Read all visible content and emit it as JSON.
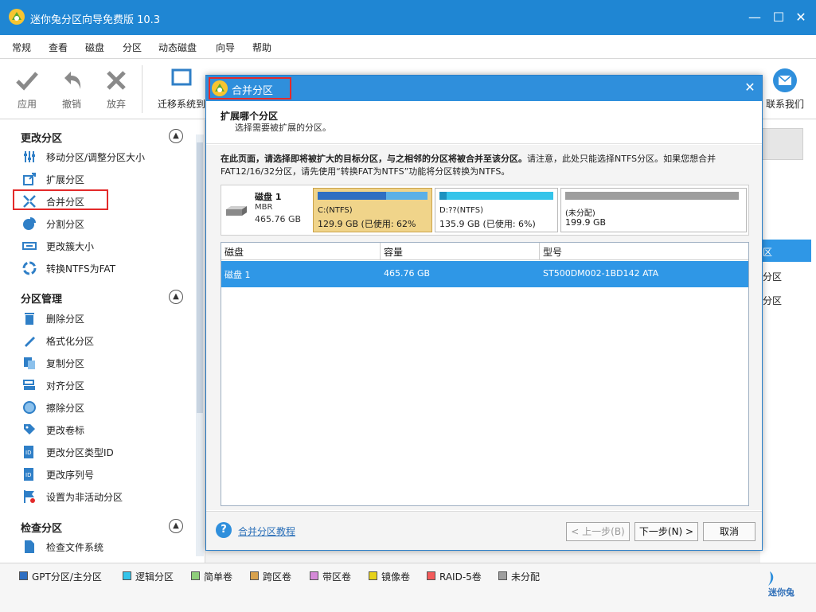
{
  "window": {
    "title": "迷你兔分区向导免费版 10.3",
    "minimize": "—",
    "maximize": "☐",
    "close": "✕"
  },
  "menu": [
    "常规",
    "查看",
    "磁盘",
    "分区",
    "动态磁盘",
    "向导",
    "帮助"
  ],
  "toolbar": {
    "apply": "应用",
    "undo": "撤销",
    "discard": "放弃",
    "migrate": "迁移系统到",
    "contact": "联系我们"
  },
  "sidebar": {
    "sections": [
      {
        "title": "更改分区",
        "items": [
          "移动分区/调整分区大小",
          "扩展分区",
          "合并分区",
          "分割分区",
          "更改簇大小",
          "转换NTFS为FAT"
        ]
      },
      {
        "title": "分区管理",
        "items": [
          "删除分区",
          "格式化分区",
          "复制分区",
          "对齐分区",
          "擦除分区",
          "更改卷标",
          "更改分区类型ID",
          "更改序列号",
          "设置为非活动分区"
        ]
      },
      {
        "title": "检查分区",
        "items": [
          "检查文件系统"
        ]
      }
    ]
  },
  "background_right": {
    "items": [
      "区",
      "分区",
      "分区"
    ]
  },
  "legend": [
    {
      "label": "GPT分区/主分区",
      "color": "#2f6fc2"
    },
    {
      "label": "逻辑分区",
      "color": "#35c4ea"
    },
    {
      "label": "简单卷",
      "color": "#8fce7b"
    },
    {
      "label": "跨区卷",
      "color": "#d8a24e"
    },
    {
      "label": "带区卷",
      "color": "#d58ad8"
    },
    {
      "label": "镜像卷",
      "color": "#e6d21b"
    },
    {
      "label": "RAID-5卷",
      "color": "#f35b5b"
    },
    {
      "label": "未分配",
      "color": "#9e9e9e"
    }
  ],
  "brand": "迷你兔",
  "dialog": {
    "title": "合并分区",
    "close": "✕",
    "heading": "扩展哪个分区",
    "subheading": "选择需要被扩展的分区。",
    "desc_bold": "在此页面，请选择即将被扩大的目标分区，与之相邻的分区将被合并至该分区。",
    "desc_rest": "请注意，此处只能选择NTFS分区。如果您想合并FAT12/16/32分区，请先使用“转换FAT为NTFS”功能将分区转换为NTFS。",
    "disk": {
      "name": "磁盘 1",
      "type": "MBR",
      "size": "465.76 GB"
    },
    "partitions": [
      {
        "label": "C:(NTFS)",
        "detail": "129.9 GB (已使用: 62%",
        "used": 0.62,
        "selected": true
      },
      {
        "label": "D:??(NTFS)",
        "detail": "135.9 GB (已使用: 6%)",
        "used": 0.06,
        "selected": false
      },
      {
        "label": "(未分配)",
        "detail": "199.9 GB",
        "used": 0,
        "selected": false
      }
    ],
    "table": {
      "headers": [
        "磁盘",
        "容量",
        "型号"
      ],
      "row": [
        "磁盘 1",
        "465.76 GB",
        "ST500DM002-1BD142 ATA"
      ]
    },
    "help_link": "合并分区教程",
    "buttons": {
      "back": "< 上一步(B)",
      "next": "下一步(N) >",
      "cancel": "取消"
    }
  }
}
